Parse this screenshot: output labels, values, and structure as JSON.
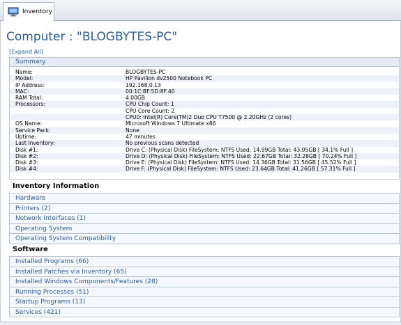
{
  "tab": {
    "label": "Inventory",
    "icon": "computer-monitor-icon"
  },
  "page": {
    "title": "Computer : \"BLOGBYTES-PC\"",
    "expand_all": "[Expand All]"
  },
  "summary": {
    "header": "Summary",
    "rows": [
      {
        "label": "Name:",
        "value": "BLOGBYTES-PC"
      },
      {
        "label": "Model:",
        "value": "HP Pavilion dv2500 Notebook PC"
      },
      {
        "label": "IP Address:",
        "value": "192.168.0.13"
      },
      {
        "label": "MAC:",
        "value": "00:1C:BF:5D:8F:40"
      },
      {
        "label": "RAM Total:",
        "value": "4.00GB"
      },
      {
        "label": "Processors:",
        "value": "CPU Chip Count: 1"
      },
      {
        "label": "",
        "value": "CPU Core Count: 2"
      },
      {
        "label": "",
        "value": "CPU0: Intel(R) Core(TM)2 Duo CPU T7500 @ 2.20GHz (2 cores)"
      },
      {
        "label": "OS Name:",
        "value": "Microsoft Windows 7 Ultimate x86"
      },
      {
        "label": "Service Pack:",
        "value": "None"
      },
      {
        "label": "Uptime:",
        "value": "47 minutes"
      },
      {
        "label": "Last Inventory:",
        "value": "No previous scans detected"
      },
      {
        "label": "Disk #1:",
        "value": "Drive C: (Physical Disk) FileSystem: NTFS Used: 14.99GB Total: 43.95GB [ 34.1% Full ]"
      },
      {
        "label": "Disk #2:",
        "value": "Drive D: (Physical Disk) FileSystem: NTFS Used: 22.67GB Total: 32.28GB [ 70.24% Full ]"
      },
      {
        "label": "Disk #3:",
        "value": "Drive E: (Physical Disk) FileSystem: NTFS Used: 14.36GB Total: 31.56GB [ 45.52% Full ]"
      },
      {
        "label": "Disk #4:",
        "value": "Drive F: (Physical Disk) FileSystem: NTFS Used: 23.64GB Total: 41.26GB [ 57.31% Full ]"
      }
    ]
  },
  "inventory": {
    "title": "Inventory Information",
    "items": [
      "Hardware",
      "Printers (2)",
      "Network Interfaces (1)",
      "Operating System",
      "Operating System Compatibility"
    ]
  },
  "software": {
    "title": "Software",
    "items": [
      "Installed Programs (66)",
      "Installed Patches via Inventory (65)",
      "Installed Windows Components/Features (28)",
      "Running Processes (51)",
      "Startup Programs (13)",
      "Services (421)"
    ]
  }
}
